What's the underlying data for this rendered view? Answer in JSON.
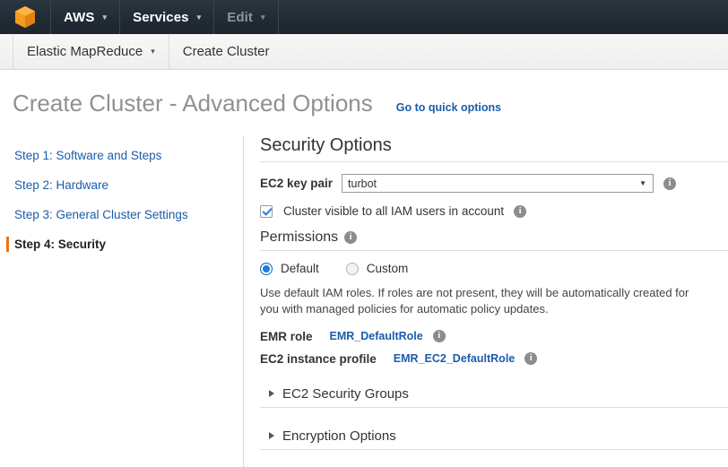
{
  "topnav": {
    "logo_icon": "aws-cube-icon",
    "items": [
      {
        "label": "AWS",
        "caret": "▾",
        "dim": false
      },
      {
        "label": "Services",
        "caret": "▾",
        "dim": false
      },
      {
        "label": "Edit",
        "caret": "▾",
        "dim": true
      }
    ]
  },
  "breadcrumb": {
    "service": "Elastic MapReduce",
    "service_caret": "▾",
    "current": "Create Cluster"
  },
  "page": {
    "title": "Create Cluster - Advanced Options",
    "quick_options_link": "Go to quick options"
  },
  "sidebar": {
    "steps": [
      {
        "label": "Step 1: Software and Steps",
        "active": false
      },
      {
        "label": "Step 2: Hardware",
        "active": false
      },
      {
        "label": "Step 3: General Cluster Settings",
        "active": false
      },
      {
        "label": "Step 4: Security",
        "active": true
      }
    ]
  },
  "main": {
    "section_title": "Security Options",
    "key_pair": {
      "label": "EC2 key pair",
      "value": "turbot",
      "arrow": "▼",
      "info": "i"
    },
    "iam_visible": {
      "label": "Cluster visible to all IAM users in account",
      "checked": true,
      "info": "i"
    },
    "permissions": {
      "title": "Permissions",
      "info": "i",
      "options": [
        {
          "label": "Default",
          "selected": true
        },
        {
          "label": "Custom",
          "selected": false
        }
      ],
      "description": "Use default IAM roles. If roles are not present, they will be automatically created for you with managed policies for automatic policy updates.",
      "emr_role": {
        "label": "EMR role",
        "value": "EMR_DefaultRole",
        "info": "i"
      },
      "ec2_profile": {
        "label": "EC2 instance profile",
        "value": "EMR_EC2_DefaultRole",
        "info": "i"
      }
    },
    "collapsibles": [
      {
        "label": "EC2 Security Groups",
        "expanded": false
      },
      {
        "label": "Encryption Options",
        "expanded": false
      }
    ]
  },
  "colors": {
    "nav_background": "#232f3e",
    "accent_orange": "#ec7211",
    "link_blue": "#1c5cab",
    "control_blue": "#1f7bd6"
  }
}
